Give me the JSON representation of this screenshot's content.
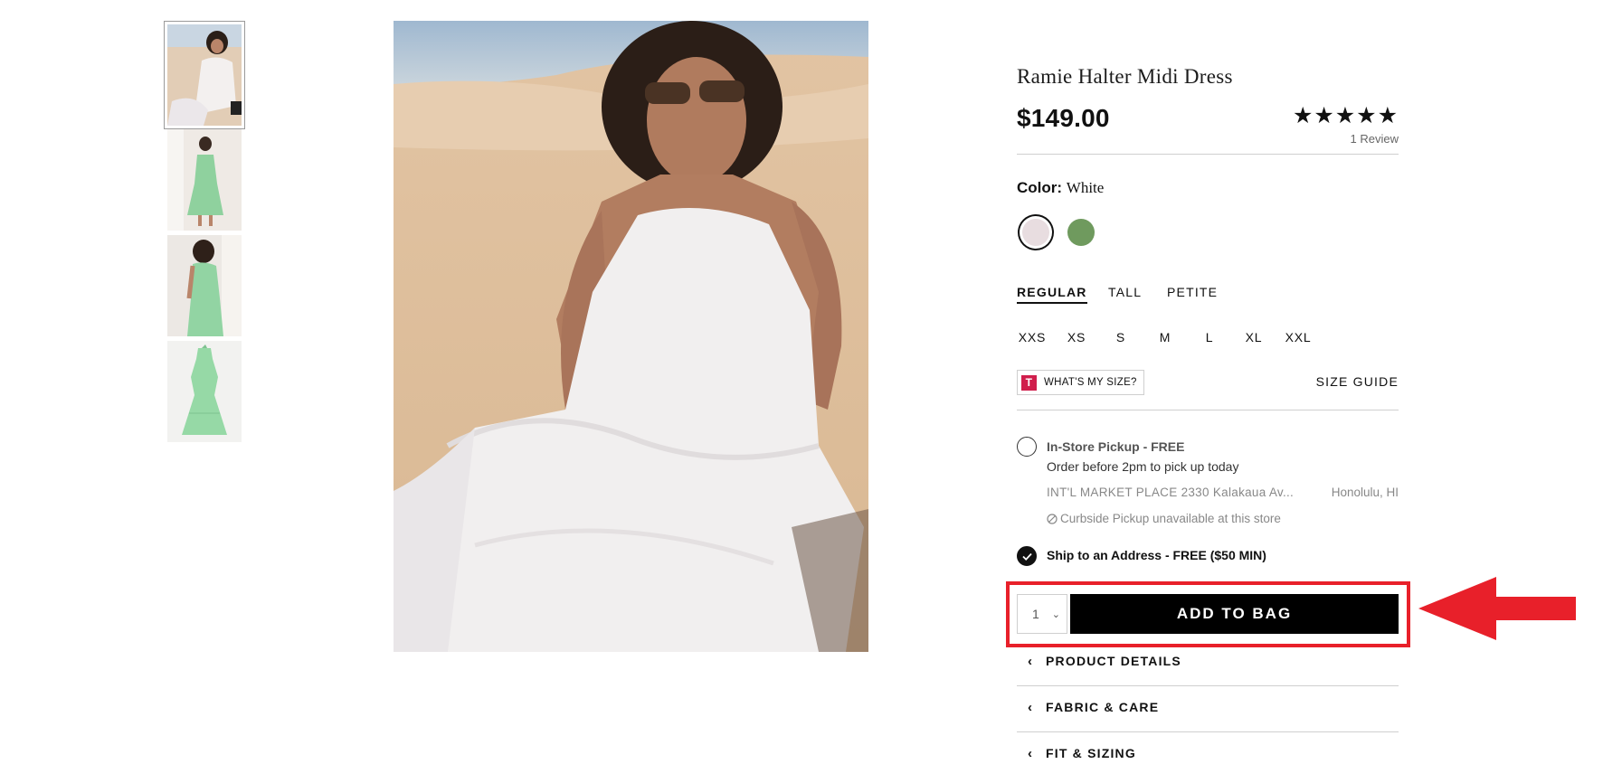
{
  "product": {
    "title": "Ramie Halter Midi Dress",
    "price": "$149.00",
    "stars": "★★★★★",
    "rating": 5,
    "reviews": "1 Review"
  },
  "color": {
    "label": "Color:",
    "value": "White",
    "swatches": [
      {
        "name": "White",
        "hex": "#e8dde0",
        "selected": true
      },
      {
        "name": "Green",
        "hex": "#6f9a5e",
        "selected": false
      }
    ]
  },
  "fits": [
    {
      "label": "REGULAR",
      "active": true
    },
    {
      "label": "TALL",
      "active": false
    },
    {
      "label": "PETITE",
      "active": false
    }
  ],
  "sizes": [
    "XXS",
    "XS",
    "S",
    "M",
    "L",
    "XL",
    "XXL"
  ],
  "whats_my_size": {
    "badge": "T",
    "label": "WHAT'S MY SIZE?"
  },
  "size_guide": "SIZE GUIDE",
  "pickup": {
    "title": "In-Store Pickup - FREE",
    "subtitle": "Order before 2pm to pick up today",
    "store": "INT'L MARKET PLACE 2330 Kalakaua Av...",
    "city": "Honolulu, HI",
    "curbside": "Curbside Pickup unavailable at this store"
  },
  "ship": {
    "label": "Ship to an Address - FREE ($50 MIN)",
    "selected": true
  },
  "quantity": "1",
  "add_to_bag": "ADD TO BAG",
  "accordions": [
    "PRODUCT DETAILS",
    "FABRIC & CARE",
    "FIT & SIZING"
  ],
  "annotation_color": "#e8202a"
}
